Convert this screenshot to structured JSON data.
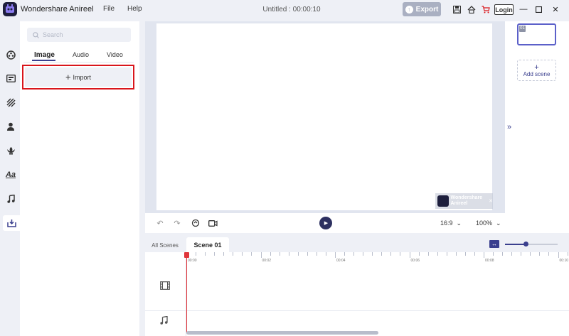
{
  "app": {
    "name": "Wondershare Anireel",
    "menu": [
      "File",
      "Help"
    ],
    "document_title": "Untitled : 00:00:10",
    "export_label": "Export",
    "login_label": "Login"
  },
  "sidebar": {
    "items": [
      {
        "name": "character",
        "icon": "character-icon"
      },
      {
        "name": "media",
        "icon": "media-icon"
      },
      {
        "name": "background",
        "icon": "background-icon"
      },
      {
        "name": "person",
        "icon": "person-icon"
      },
      {
        "name": "props",
        "icon": "props-icon"
      },
      {
        "name": "text",
        "icon": "text-icon",
        "glyph": "Aa"
      },
      {
        "name": "audio",
        "icon": "music-icon"
      },
      {
        "name": "import",
        "icon": "import-icon",
        "active": true
      }
    ]
  },
  "library": {
    "search_placeholder": "Search",
    "tabs": [
      "Image",
      "Audio",
      "Video"
    ],
    "active_tab": "Image",
    "import_label": "Import"
  },
  "preview": {
    "watermark_line1": "Wondershare",
    "watermark_line2": "Anireel",
    "aspect_ratio": "16:9",
    "zoom": "100%"
  },
  "scenes": {
    "thumb_number": "01",
    "add_scene_label": "Add scene"
  },
  "timeline": {
    "tabs": [
      "All Scenes",
      "Scene 01"
    ],
    "ruler_labels": [
      "00:00",
      "00:02",
      "00:04",
      "00:06",
      "00:08",
      "00:10"
    ]
  },
  "colors": {
    "accent": "#3a3f8e",
    "highlight_outline": "#d9151b",
    "playhead": "#e0353b",
    "background": "#eef0f6"
  }
}
